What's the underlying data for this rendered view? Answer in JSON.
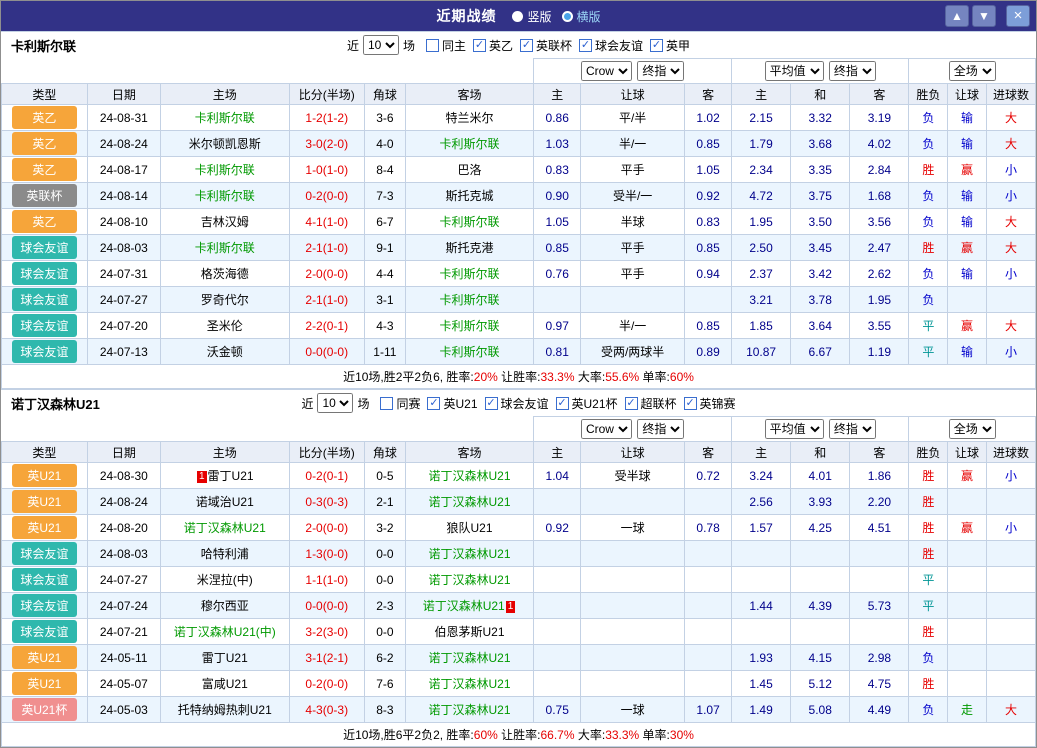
{
  "titlebar": {
    "title": "近期战绩",
    "layout_vertical": "竖版",
    "layout_horizontal": "横版"
  },
  "icons": {
    "up": "▲",
    "down": "▼",
    "close": "×"
  },
  "table_headers": [
    "类型",
    "日期",
    "主场",
    "比分(半场)",
    "角球",
    "客场",
    "主",
    "让球",
    "客",
    "主",
    "和",
    "客",
    "胜负",
    "让球",
    "进球数"
  ],
  "odds_selects": {
    "company": "Crow",
    "company_final": "终指",
    "average": "平均值",
    "average_final": "终指",
    "fulltime": "全场"
  },
  "sections": [
    {
      "team": "卡利斯尔联",
      "filter": {
        "near_label": "近",
        "count": "10",
        "unit_label": "场",
        "checkboxes": [
          {
            "label": "同主",
            "checked": false
          },
          {
            "label": "英乙",
            "checked": true
          },
          {
            "label": "英联杯",
            "checked": true
          },
          {
            "label": "球会友谊",
            "checked": true
          },
          {
            "label": "英甲",
            "checked": true
          }
        ]
      },
      "rows": [
        {
          "type": "英乙",
          "type_style": "orange",
          "date": "24-08-31",
          "home": "卡利斯尔联",
          "home_green": true,
          "score": "1-2(1-2)",
          "corner": "3-6",
          "away": "特兰米尔",
          "away_green": false,
          "crow": [
            "0.86",
            "平/半",
            "1.02"
          ],
          "avg": [
            "2.15",
            "3.32",
            "3.19"
          ],
          "res": [
            "负",
            "输",
            "大"
          ]
        },
        {
          "type": "英乙",
          "type_style": "orange",
          "date": "24-08-24",
          "home": "米尔顿凯恩斯",
          "home_green": false,
          "score": "3-0(2-0)",
          "corner": "4-0",
          "away": "卡利斯尔联",
          "away_green": true,
          "crow": [
            "1.03",
            "半/一",
            "0.85"
          ],
          "avg": [
            "1.79",
            "3.68",
            "4.02"
          ],
          "res": [
            "负",
            "输",
            "大"
          ]
        },
        {
          "type": "英乙",
          "type_style": "orange",
          "date": "24-08-17",
          "home": "卡利斯尔联",
          "home_green": true,
          "score": "1-0(1-0)",
          "corner": "8-4",
          "away": "巴洛",
          "away_green": false,
          "crow": [
            "0.83",
            "平手",
            "1.05"
          ],
          "avg": [
            "2.34",
            "3.35",
            "2.84"
          ],
          "res": [
            "胜",
            "赢",
            "小"
          ]
        },
        {
          "type": "英联杯",
          "type_style": "gray",
          "date": "24-08-14",
          "home": "卡利斯尔联",
          "home_green": true,
          "score": "0-2(0-0)",
          "corner": "7-3",
          "away": "斯托克城",
          "away_green": false,
          "crow": [
            "0.90",
            "受半/一",
            "0.92"
          ],
          "avg": [
            "4.72",
            "3.75",
            "1.68"
          ],
          "res": [
            "负",
            "输",
            "小"
          ]
        },
        {
          "type": "英乙",
          "type_style": "orange",
          "date": "24-08-10",
          "home": "吉林汉姆",
          "home_green": false,
          "score": "4-1(1-0)",
          "corner": "6-7",
          "away": "卡利斯尔联",
          "away_green": true,
          "crow": [
            "1.05",
            "半球",
            "0.83"
          ],
          "avg": [
            "1.95",
            "3.50",
            "3.56"
          ],
          "res": [
            "负",
            "输",
            "大"
          ]
        },
        {
          "type": "球会友谊",
          "type_style": "teal",
          "date": "24-08-03",
          "home": "卡利斯尔联",
          "home_green": true,
          "score": "2-1(1-0)",
          "corner": "9-1",
          "away": "斯托克港",
          "away_green": false,
          "crow": [
            "0.85",
            "平手",
            "0.85"
          ],
          "avg": [
            "2.50",
            "3.45",
            "2.47"
          ],
          "res": [
            "胜",
            "赢",
            "大"
          ]
        },
        {
          "type": "球会友谊",
          "type_style": "teal",
          "date": "24-07-31",
          "home": "格茨海德",
          "home_green": false,
          "score": "2-0(0-0)",
          "corner": "4-4",
          "away": "卡利斯尔联",
          "away_green": true,
          "crow": [
            "0.76",
            "平手",
            "0.94"
          ],
          "avg": [
            "2.37",
            "3.42",
            "2.62"
          ],
          "res": [
            "负",
            "输",
            "小"
          ]
        },
        {
          "type": "球会友谊",
          "type_style": "teal",
          "date": "24-07-27",
          "home": "罗奇代尔",
          "home_green": false,
          "score": "2-1(1-0)",
          "corner": "3-1",
          "away": "卡利斯尔联",
          "away_green": true,
          "crow": [
            "",
            "",
            ""
          ],
          "avg": [
            "3.21",
            "3.78",
            "1.95"
          ],
          "res": [
            "负",
            "",
            ""
          ]
        },
        {
          "type": "球会友谊",
          "type_style": "teal",
          "date": "24-07-20",
          "home": "圣米伦",
          "home_green": false,
          "score": "2-2(0-1)",
          "corner": "4-3",
          "away": "卡利斯尔联",
          "away_green": true,
          "crow": [
            "0.97",
            "半/一",
            "0.85"
          ],
          "avg": [
            "1.85",
            "3.64",
            "3.55"
          ],
          "res": [
            "平",
            "赢",
            "大"
          ]
        },
        {
          "type": "球会友谊",
          "type_style": "teal",
          "date": "24-07-13",
          "home": "沃金顿",
          "home_green": false,
          "score": "0-0(0-0)",
          "corner": "1-11",
          "away": "卡利斯尔联",
          "away_green": true,
          "crow": [
            "0.81",
            "受两/两球半",
            "0.89"
          ],
          "avg": [
            "10.87",
            "6.67",
            "1.19"
          ],
          "res": [
            "平",
            "输",
            "小"
          ]
        }
      ],
      "summary": [
        {
          "t": "近10场,胜2平2负6, 胜率:",
          "c": "k"
        },
        {
          "t": "20%",
          "c": "r"
        },
        {
          "t": " 让胜率:",
          "c": "k"
        },
        {
          "t": "33.3%",
          "c": "r"
        },
        {
          "t": " 大率:",
          "c": "k"
        },
        {
          "t": "55.6%",
          "c": "r"
        },
        {
          "t": " 单率:",
          "c": "k"
        },
        {
          "t": "60%",
          "c": "r"
        }
      ]
    },
    {
      "team": "诺丁汉森林U21",
      "filter": {
        "near_label": "近",
        "count": "10",
        "unit_label": "场",
        "checkboxes": [
          {
            "label": "同赛",
            "checked": false
          },
          {
            "label": "英U21",
            "checked": true
          },
          {
            "label": "球会友谊",
            "checked": true
          },
          {
            "label": "英U21杯",
            "checked": true
          },
          {
            "label": "超联杯",
            "checked": true
          },
          {
            "label": "英锦赛",
            "checked": true
          }
        ]
      },
      "rows": [
        {
          "type": "英U21",
          "type_style": "orange",
          "date": "24-08-30",
          "home": "雷丁U21",
          "home_green": false,
          "home_mark": "1",
          "score": "0-2(0-1)",
          "corner": "0-5",
          "away": "诺丁汉森林U21",
          "away_green": true,
          "crow": [
            "1.04",
            "受半球",
            "0.72"
          ],
          "avg": [
            "3.24",
            "4.01",
            "1.86"
          ],
          "res": [
            "胜",
            "赢",
            "小"
          ]
        },
        {
          "type": "英U21",
          "type_style": "orange",
          "date": "24-08-24",
          "home": "诺域治U21",
          "home_green": false,
          "score": "0-3(0-3)",
          "corner": "2-1",
          "away": "诺丁汉森林U21",
          "away_green": true,
          "crow": [
            "",
            "",
            ""
          ],
          "avg": [
            "2.56",
            "3.93",
            "2.20"
          ],
          "res": [
            "胜",
            "",
            ""
          ]
        },
        {
          "type": "英U21",
          "type_style": "orange",
          "date": "24-08-20",
          "home": "诺丁汉森林U21",
          "home_green": true,
          "score": "2-0(0-0)",
          "corner": "3-2",
          "away": "狼队U21",
          "away_green": false,
          "crow": [
            "0.92",
            "一球",
            "0.78"
          ],
          "avg": [
            "1.57",
            "4.25",
            "4.51"
          ],
          "res": [
            "胜",
            "赢",
            "小"
          ]
        },
        {
          "type": "球会友谊",
          "type_style": "teal",
          "date": "24-08-03",
          "home": "哈特利浦",
          "home_green": false,
          "score": "1-3(0-0)",
          "corner": "0-0",
          "away": "诺丁汉森林U21",
          "away_green": true,
          "crow": [
            "",
            "",
            ""
          ],
          "avg": [
            "",
            "",
            ""
          ],
          "res": [
            "胜",
            "",
            ""
          ]
        },
        {
          "type": "球会友谊",
          "type_style": "teal",
          "date": "24-07-27",
          "home": "米涅拉(中)",
          "home_green": false,
          "score": "1-1(1-0)",
          "corner": "0-0",
          "away": "诺丁汉森林U21",
          "away_green": true,
          "crow": [
            "",
            "",
            ""
          ],
          "avg": [
            "",
            "",
            ""
          ],
          "res": [
            "平",
            "",
            ""
          ]
        },
        {
          "type": "球会友谊",
          "type_style": "teal",
          "date": "24-07-24",
          "home": "穆尔西亚",
          "home_green": false,
          "score": "0-0(0-0)",
          "corner": "2-3",
          "away": "诺丁汉森林U21",
          "away_green": true,
          "away_mark": "1",
          "crow": [
            "",
            "",
            ""
          ],
          "avg": [
            "1.44",
            "4.39",
            "5.73"
          ],
          "res": [
            "平",
            "",
            ""
          ]
        },
        {
          "type": "球会友谊",
          "type_style": "teal",
          "date": "24-07-21",
          "home": "诺丁汉森林U21(中)",
          "home_green": true,
          "score": "3-2(3-0)",
          "corner": "0-0",
          "away": "伯恩茅斯U21",
          "away_green": false,
          "crow": [
            "",
            "",
            ""
          ],
          "avg": [
            "",
            "",
            ""
          ],
          "res": [
            "胜",
            "",
            ""
          ]
        },
        {
          "type": "英U21",
          "type_style": "orange",
          "date": "24-05-11",
          "home": "雷丁U21",
          "home_green": false,
          "score": "3-1(2-1)",
          "corner": "6-2",
          "away": "诺丁汉森林U21",
          "away_green": true,
          "crow": [
            "",
            "",
            ""
          ],
          "avg": [
            "1.93",
            "4.15",
            "2.98"
          ],
          "res": [
            "负",
            "",
            ""
          ]
        },
        {
          "type": "英U21",
          "type_style": "orange",
          "date": "24-05-07",
          "home": "富咸U21",
          "home_green": false,
          "score": "0-2(0-0)",
          "corner": "7-6",
          "away": "诺丁汉森林U21",
          "away_green": true,
          "crow": [
            "",
            "",
            ""
          ],
          "avg": [
            "1.45",
            "5.12",
            "4.75"
          ],
          "res": [
            "胜",
            "",
            ""
          ]
        },
        {
          "type": "英U21杯",
          "type_style": "pink",
          "date": "24-05-03",
          "home": "托特纳姆热刺U21",
          "home_green": false,
          "score": "4-3(0-3)",
          "corner": "8-3",
          "away": "诺丁汉森林U21",
          "away_green": true,
          "crow": [
            "0.75",
            "一球",
            "1.07"
          ],
          "avg": [
            "1.49",
            "5.08",
            "4.49"
          ],
          "res": [
            "负",
            "走",
            "大"
          ]
        }
      ],
      "summary": [
        {
          "t": "近10场,胜6平2负2, 胜率:",
          "c": "k"
        },
        {
          "t": "60%",
          "c": "r"
        },
        {
          "t": " 让胜率:",
          "c": "k"
        },
        {
          "t": "66.7%",
          "c": "r"
        },
        {
          "t": " 大率:",
          "c": "k"
        },
        {
          "t": "33.3%",
          "c": "r"
        },
        {
          "t": " 单率:",
          "c": "k"
        },
        {
          "t": "30%",
          "c": "r"
        }
      ]
    }
  ]
}
